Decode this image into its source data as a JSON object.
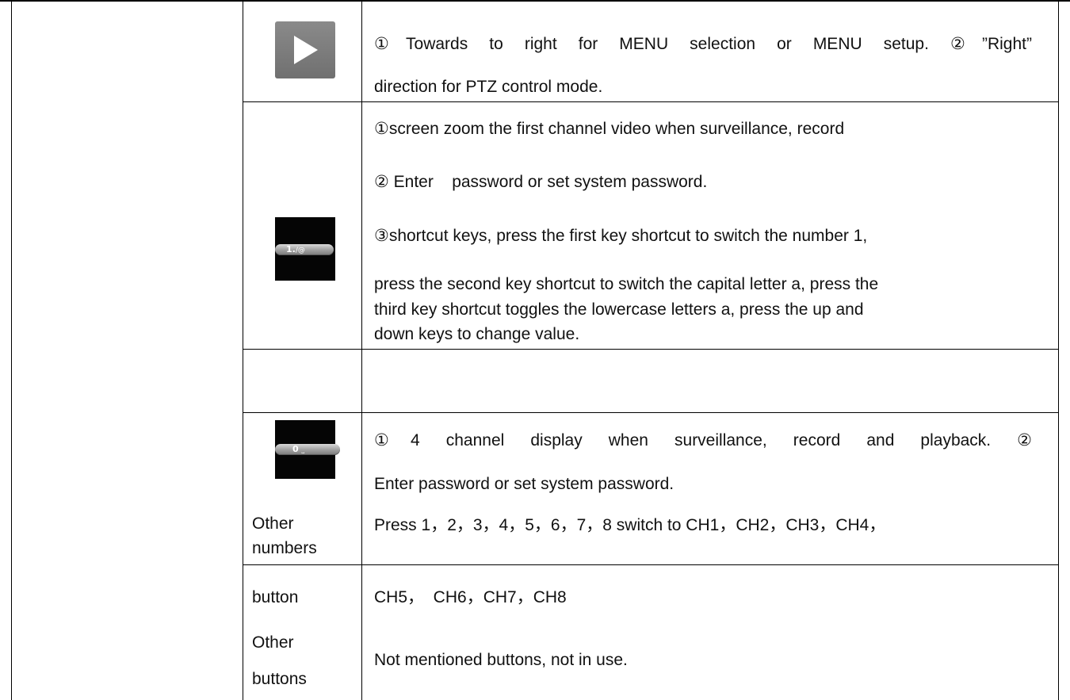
{
  "rows": {
    "right_key": {
      "icon": "right-arrow-icon",
      "line1": "①Towards to right for MENU selection or MENU setup. ②”Right”",
      "line2": "direction for PTZ control mode."
    },
    "key_1": {
      "key_label": "1.",
      "key_symbol": "/@",
      "line1": "①screen zoom the first channel video when surveillance, record",
      "line2": "② Enter    password or set system password.",
      "line3": "③shortcut keys, press the first key shortcut to switch the number 1,",
      "line4": "press the second key shortcut to switch the capital letter a, press the",
      "line5": "third key shortcut toggles the lowercase letters a, press the up and",
      "line6": "down keys to change value."
    },
    "key_0": {
      "key_label": "0",
      "key_symbol": "⎵",
      "line1": "①4 channel display when surveillance, record and playback. ②",
      "line2": "Enter password or set system password."
    },
    "other_numbers": {
      "label_line1": "Other",
      "label_line2": "numbers",
      "label_line3": "button",
      "line1": "Press 1，2，3，4，5，6，7，8 switch to CH1，CH2，CH3，CH4，",
      "line2": "CH5，  CH6，CH7，CH8"
    },
    "other_buttons": {
      "label_line1": "Other",
      "label_line2": "buttons",
      "line1": "Not mentioned buttons, not in use."
    }
  }
}
